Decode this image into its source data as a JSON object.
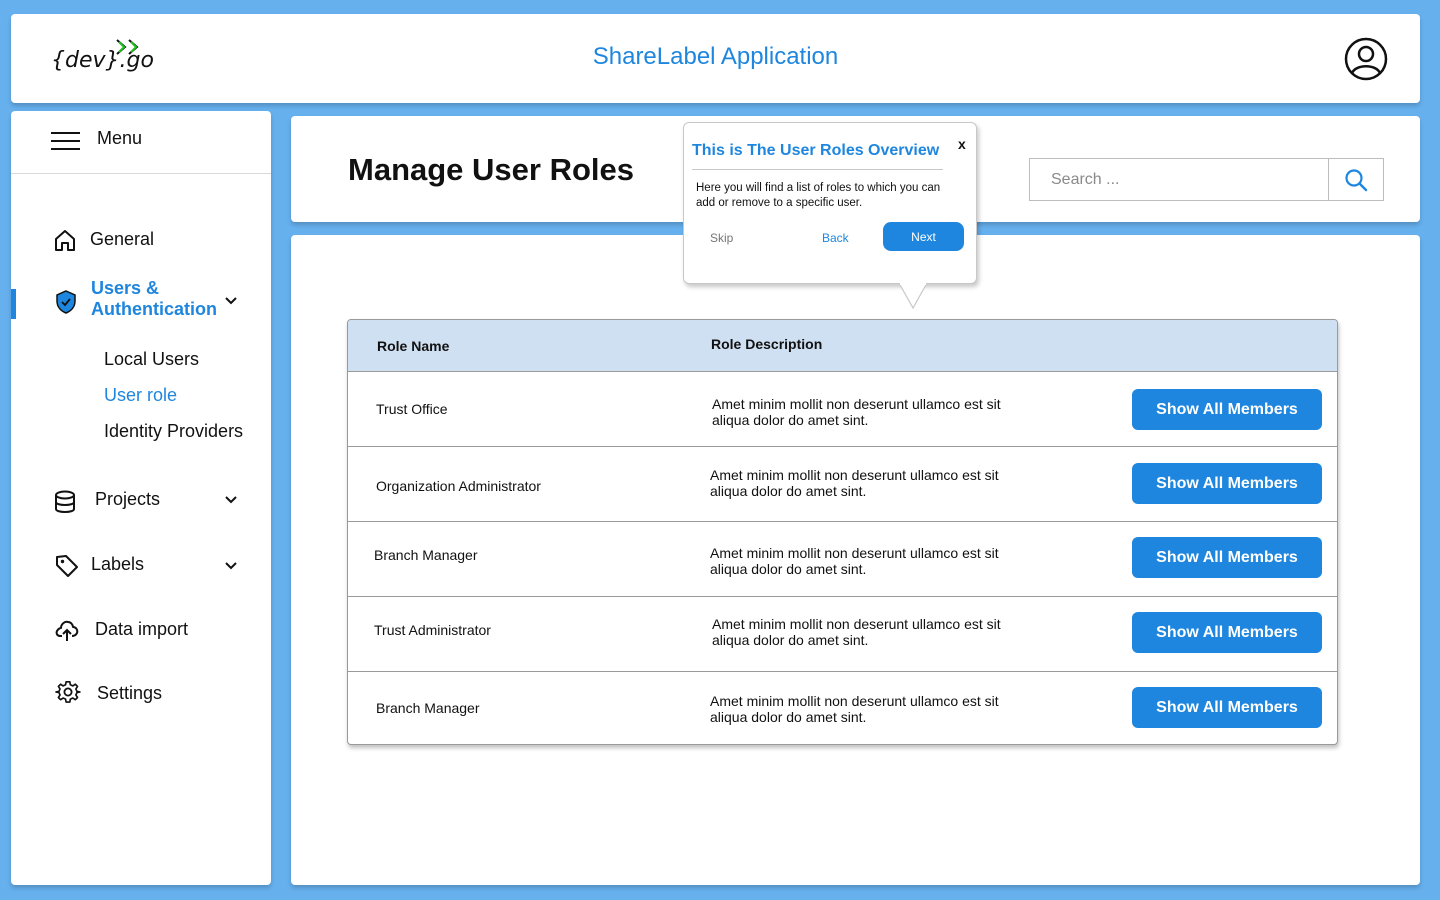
{
  "header": {
    "logo_text": "{dev}.go",
    "app_title": "ShareLabel Application"
  },
  "sidebar": {
    "menu_label": "Menu",
    "items": [
      {
        "label": "General",
        "icon": "home-icon"
      },
      {
        "label": "Users & Authentication",
        "icon": "shield-icon"
      },
      {
        "label": "Projects",
        "icon": "database-icon"
      },
      {
        "label": "Labels",
        "icon": "tag-icon"
      },
      {
        "label": "Data import",
        "icon": "cloud-upload-icon"
      },
      {
        "label": "Settings",
        "icon": "gear-icon"
      }
    ],
    "users_line1": "Users &",
    "users_line2": "Authentication",
    "sub_items": [
      {
        "label": "Local Users"
      },
      {
        "label": "User role"
      },
      {
        "label": "Identity Providers"
      }
    ]
  },
  "page": {
    "title": "Manage User Roles",
    "search_placeholder": "Search ..."
  },
  "table": {
    "columns": [
      "Role Name",
      "Role Description"
    ],
    "button_label": "Show All Members",
    "rows": [
      {
        "name": "Trust Office",
        "description": "Amet minim mollit non deserunt ullamco est sit aliqua dolor do amet sint."
      },
      {
        "name": "Organization Administrator",
        "description": "Amet minim mollit non deserunt ullamco est sit aliqua dolor do amet sint."
      },
      {
        "name": "Branch Manager",
        "description": "Amet minim mollit non deserunt ullamco est sit aliqua dolor do amet sint."
      },
      {
        "name": "Trust Administrator",
        "description": "Amet minim mollit non deserunt ullamco est sit aliqua dolor do amet sint."
      },
      {
        "name": "Branch Manager",
        "description": "Amet minim mollit non deserunt ullamco est sit aliqua dolor do amet sint."
      }
    ]
  },
  "popover": {
    "title": "This is The User Roles Overview",
    "close": "x",
    "body": "Here you will find a list of roles to which you can add or remove to a specific user.",
    "skip": "Skip",
    "back": "Back",
    "next": "Next"
  },
  "colors": {
    "background": "#66b0ee",
    "accent": "#1e86de",
    "table_header": "#cfe0f2"
  }
}
